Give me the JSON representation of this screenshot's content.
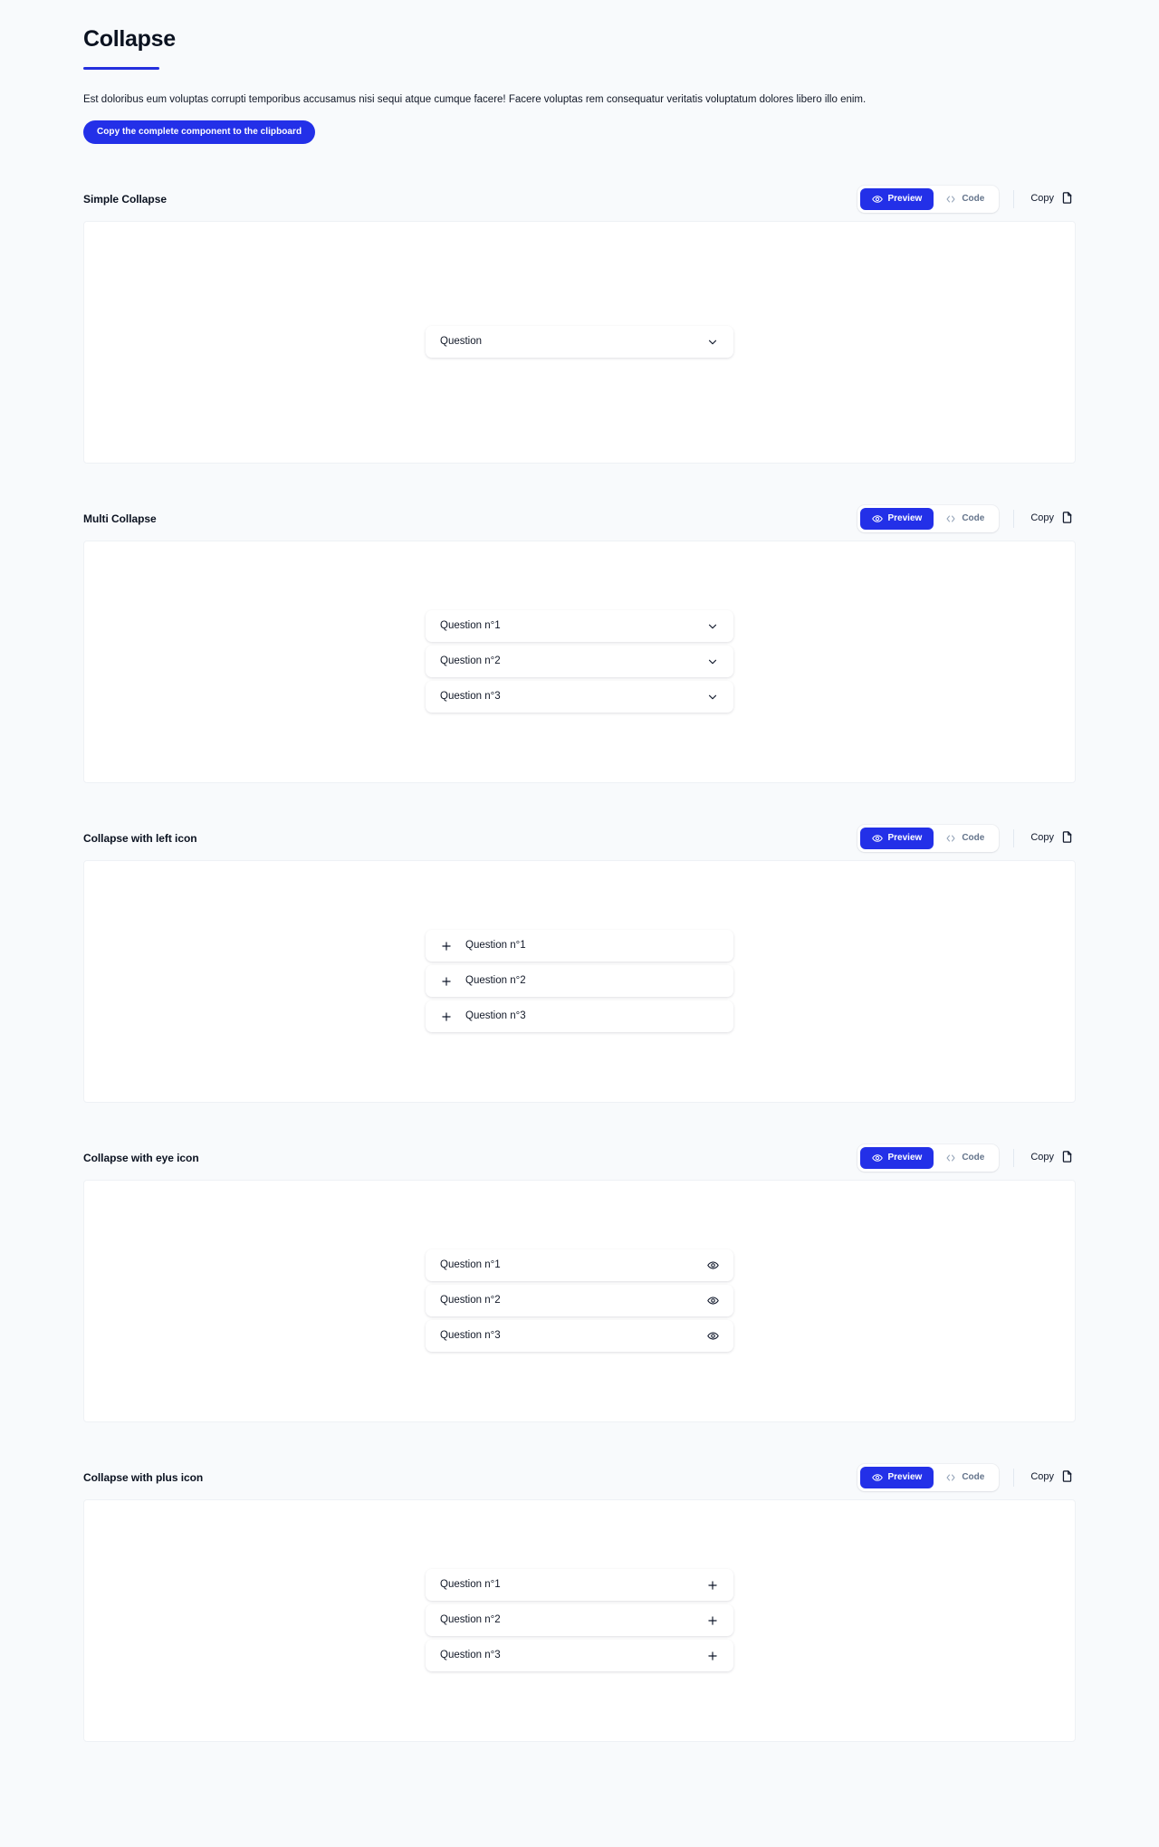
{
  "header": {
    "title": "Collapse",
    "description": "Est doloribus eum voluptas corrupti temporibus accusamus nisi sequi atque cumque facere! Facere voluptas rem consequatur veritatis voluptatum dolores libero illo enim.",
    "copy_all_label": "Copy the complete component to the clipboard",
    "accent_color": "#2330e8",
    "rule_color": "#2430dd"
  },
  "toolbar": {
    "preview_label": "Preview",
    "code_label": "Code",
    "copy_label": "Copy",
    "preview_icon": "eye-icon",
    "code_icon": "code-brackets-icon",
    "copy_icon": "document-icon",
    "active": "Preview"
  },
  "sections": [
    {
      "title": "Simple Collapse",
      "variant": "chevron-right",
      "items": [
        {
          "label": "Question",
          "right_icon": "chevron-down-icon",
          "left_icon": null
        }
      ]
    },
    {
      "title": "Multi Collapse",
      "variant": "chevron-right",
      "items": [
        {
          "label": "Question n°1",
          "right_icon": "chevron-down-icon",
          "left_icon": null
        },
        {
          "label": "Question n°2",
          "right_icon": "chevron-down-icon",
          "left_icon": null
        },
        {
          "label": "Question n°3",
          "right_icon": "chevron-down-icon",
          "left_icon": null
        }
      ]
    },
    {
      "title": "Collapse with left icon",
      "variant": "plus-left",
      "items": [
        {
          "label": "Question n°1",
          "right_icon": null,
          "left_icon": "plus-icon"
        },
        {
          "label": "Question n°2",
          "right_icon": null,
          "left_icon": "plus-icon"
        },
        {
          "label": "Question n°3",
          "right_icon": null,
          "left_icon": "plus-icon"
        }
      ]
    },
    {
      "title": "Collapse with eye icon",
      "variant": "eye-right",
      "items": [
        {
          "label": "Question n°1",
          "right_icon": "eye-icon",
          "left_icon": null
        },
        {
          "label": "Question n°2",
          "right_icon": "eye-icon",
          "left_icon": null
        },
        {
          "label": "Question n°3",
          "right_icon": "eye-icon",
          "left_icon": null
        }
      ]
    },
    {
      "title": "Collapse with plus icon",
      "variant": "plus-right",
      "items": [
        {
          "label": "Question n°1",
          "right_icon": "plus-icon",
          "left_icon": null
        },
        {
          "label": "Question n°2",
          "right_icon": "plus-icon",
          "left_icon": null
        },
        {
          "label": "Question n°3",
          "right_icon": "plus-icon",
          "left_icon": null
        }
      ]
    }
  ]
}
